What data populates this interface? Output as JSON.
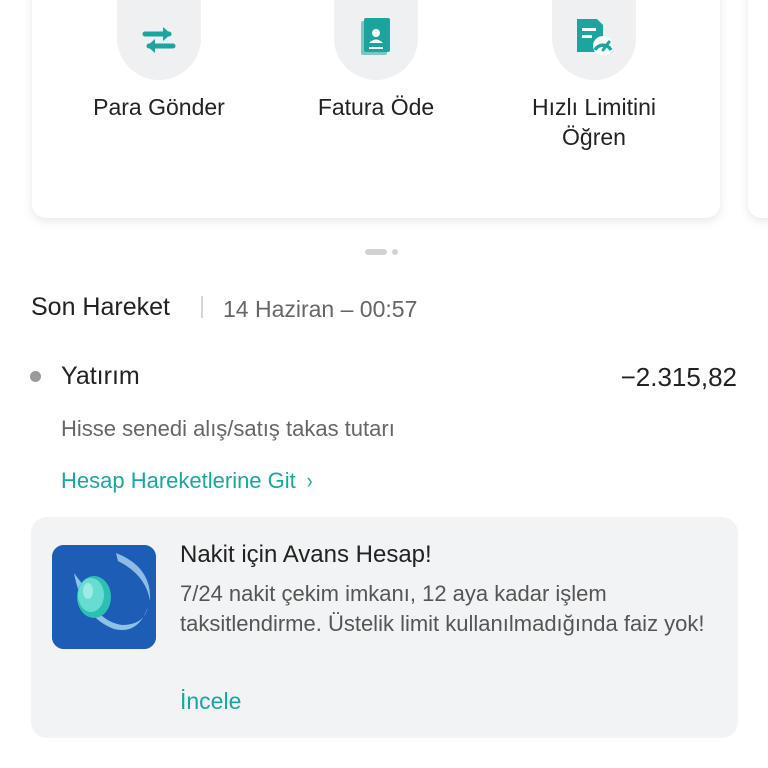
{
  "quick_actions": [
    {
      "label": "Para Gönder",
      "icon": "transfer-arrows-icon"
    },
    {
      "label": "Fatura Öde",
      "icon": "bill-receipt-icon"
    },
    {
      "label": "Hızlı Limitini Öğren",
      "icon": "limit-gauge-icon"
    }
  ],
  "last_transaction": {
    "title": "Son Hareket",
    "date": "14 Haziran – 00:57",
    "name": "Yatırım",
    "amount": "−2.315,82",
    "description": "Hisse senedi alış/satış takas tutarı",
    "history_link": "Hesap Hareketlerine Git",
    "history_chevron": "›"
  },
  "promo": {
    "title": "Nakit için Avans Hesap!",
    "body": "7/24 nakit çekim imkanı, 12 aya kadar işlem taksitlendirme. Üstelik limit kullanılmadığında faiz yok!",
    "link": "İncele",
    "image": "coin-illustration-icon"
  },
  "colors": {
    "accent": "#1aa59e",
    "icon_bg": "#eef0f1",
    "promo_bg": "#f2f3f4",
    "promo_image_bg": "#1e5db5"
  }
}
